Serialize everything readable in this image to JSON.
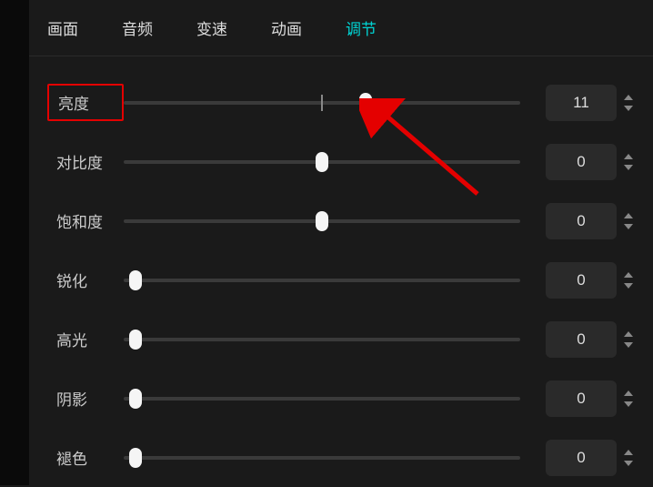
{
  "tabs": {
    "items": [
      {
        "label": "画面",
        "active": false
      },
      {
        "label": "音频",
        "active": false
      },
      {
        "label": "变速",
        "active": false
      },
      {
        "label": "动画",
        "active": false
      },
      {
        "label": "调节",
        "active": true
      }
    ]
  },
  "sliders": [
    {
      "label": "亮度",
      "value": "11",
      "percent": 61,
      "tick": 50,
      "highlighted": true
    },
    {
      "label": "对比度",
      "value": "0",
      "percent": 50,
      "tick": null,
      "highlighted": false
    },
    {
      "label": "饱和度",
      "value": "0",
      "percent": 50,
      "tick": null,
      "highlighted": false
    },
    {
      "label": "锐化",
      "value": "0",
      "percent": 3,
      "tick": null,
      "highlighted": false
    },
    {
      "label": "高光",
      "value": "0",
      "percent": 3,
      "tick": null,
      "highlighted": false
    },
    {
      "label": "阴影",
      "value": "0",
      "percent": 3,
      "tick": null,
      "highlighted": false
    },
    {
      "label": "褪色",
      "value": "0",
      "percent": 3,
      "tick": null,
      "highlighted": false
    }
  ],
  "annotation": {
    "arrow_color": "#e40000"
  }
}
